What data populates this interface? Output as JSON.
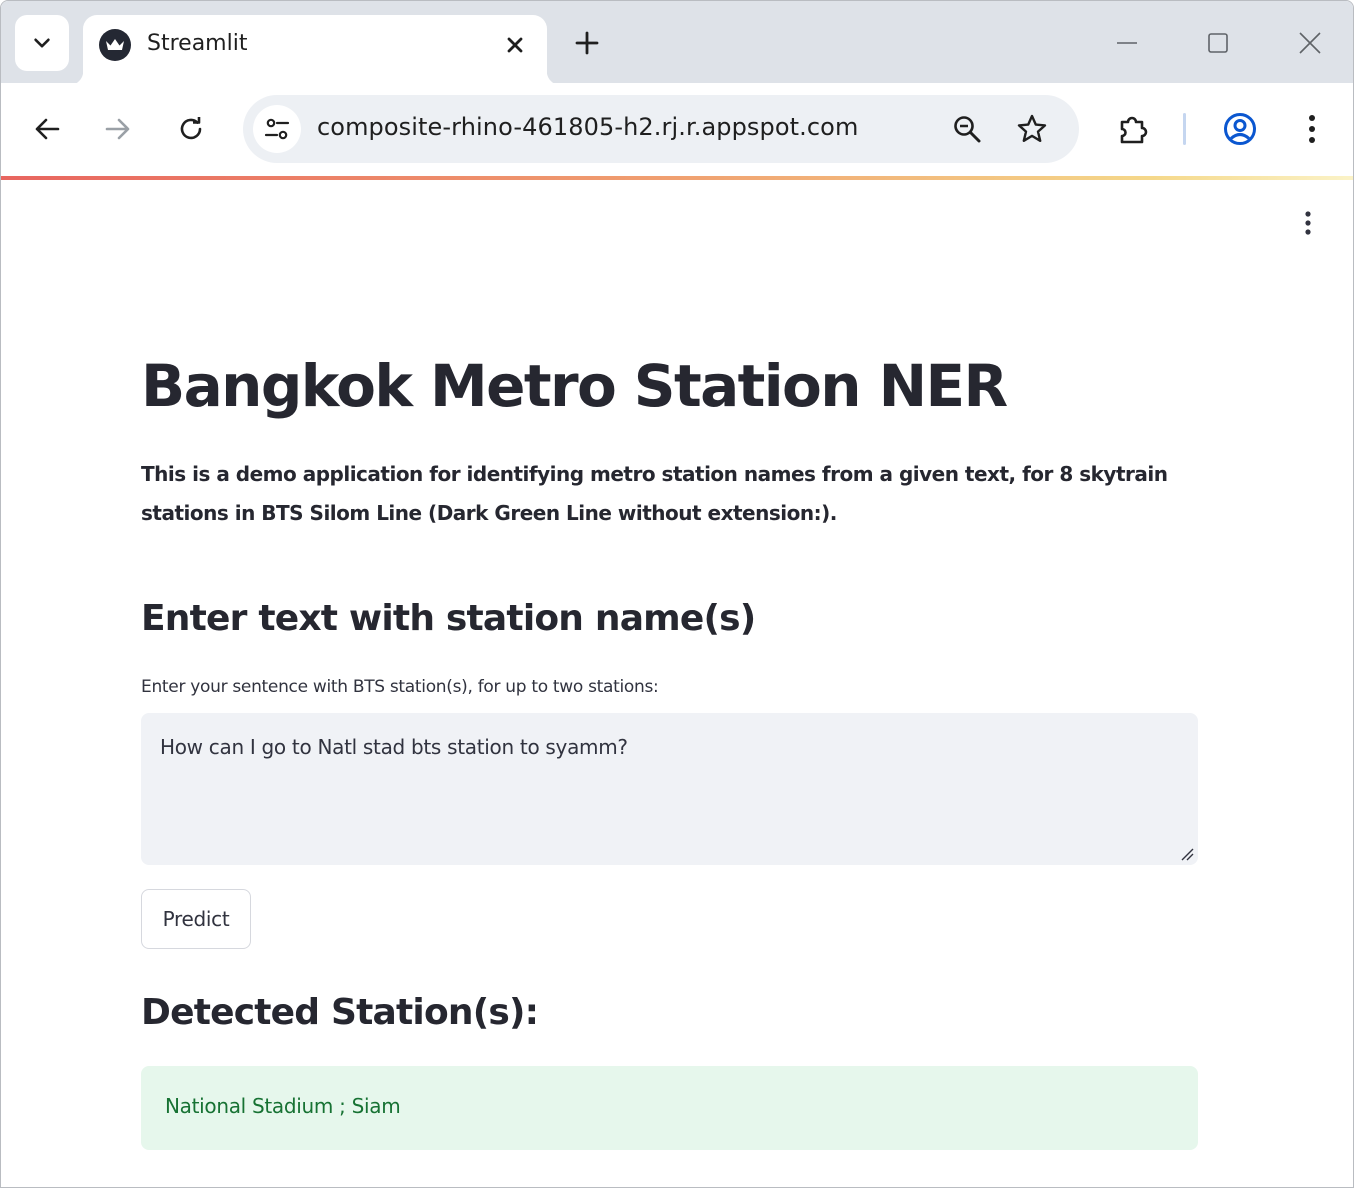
{
  "browser": {
    "tab_title": "Streamlit",
    "url": "composite-rhino-461805-h2.rj.r.appspot.com",
    "icons": {
      "tab_search": "chevron-down-icon",
      "favicon": "streamlit-crown-icon",
      "tab_close": "close-icon",
      "new_tab": "plus-icon",
      "minimize": "minimize-icon",
      "maximize": "maximize-icon",
      "close_window": "close-icon",
      "back": "arrow-left-icon",
      "forward": "arrow-right-icon",
      "reload": "reload-icon",
      "site_info": "tune-icon",
      "zoom": "zoom-icon",
      "bookmark": "star-icon",
      "extensions": "puzzle-icon",
      "profile": "account-circle-icon",
      "menu": "kebab-menu-icon"
    }
  },
  "app": {
    "title": "Bangkok Metro Station NER",
    "description": "This is a demo application for identifying metro station names from a given text, for 8 skytrain stations in BTS Silom Line (Dark Green Line without extension:).",
    "section_input_title": "Enter text with station name(s)",
    "input_label": "Enter your sentence with BTS station(s), for up to two stations:",
    "input_value": "How can I go to Natl stad bts station to syamm?",
    "predict_label": "Predict",
    "section_result_title": "Detected Station(s):",
    "result_text": "National Stadium ; Siam"
  },
  "colors": {
    "text": "#262730",
    "input_bg": "#f0f2f6",
    "success_bg": "#e6f7ec",
    "success_text": "#177233",
    "chrome_bg": "#dee2e8",
    "profile_blue": "#0b57d0"
  }
}
